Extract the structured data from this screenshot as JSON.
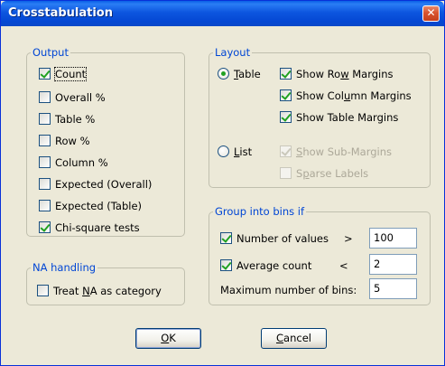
{
  "window": {
    "title": "Crosstabulation",
    "close_glyph": "✕"
  },
  "output": {
    "legend": "Output",
    "items": [
      {
        "label": "Count",
        "checked": true
      },
      {
        "label": "Overall %",
        "checked": false
      },
      {
        "label": "Table %",
        "checked": false
      },
      {
        "label": "Row %",
        "checked": false
      },
      {
        "label": "Column %",
        "checked": false
      },
      {
        "label": "Expected (Overall)",
        "checked": false
      },
      {
        "label": "Expected (Table)",
        "checked": false
      },
      {
        "label": "Chi-square tests",
        "checked": true
      }
    ]
  },
  "layout": {
    "legend": "Layout",
    "table_radio": {
      "pre": "",
      "ul": "T",
      "post": "able",
      "selected": true
    },
    "list_radio": {
      "pre": "",
      "ul": "L",
      "post": "ist",
      "selected": false
    },
    "table_options": [
      {
        "pre": "Show Ro",
        "ul": "w",
        "post": " Margins",
        "checked": true
      },
      {
        "pre": "Show Col",
        "ul": "u",
        "post": "mn Margins",
        "checked": true
      },
      {
        "pre": "Show Table Margins",
        "ul": "",
        "post": "",
        "checked": true
      }
    ],
    "list_options": [
      {
        "pre": "",
        "ul": "S",
        "post": "how Sub-Margins",
        "checked": true,
        "disabled": true
      },
      {
        "pre": "S",
        "ul": "p",
        "post": "arse Labels",
        "checked": false,
        "disabled": true
      }
    ]
  },
  "na_handling": {
    "legend": "NA handling",
    "item": {
      "pre": "Treat ",
      "ul": "N",
      "post": "A as category",
      "checked": false
    }
  },
  "bins": {
    "legend": "Group into bins if",
    "number_of_values": {
      "label": "Number of values",
      "op": ">",
      "value": "100",
      "checked": true
    },
    "average_count": {
      "label": "Average count",
      "op": "<",
      "value": "2",
      "checked": true
    },
    "max_bins": {
      "label": "Maximum number of bins:",
      "value": "5"
    }
  },
  "buttons": {
    "ok": {
      "pre": "",
      "ul": "O",
      "post": "K"
    },
    "cancel": {
      "pre": "",
      "ul": "C",
      "post": "ancel"
    }
  }
}
